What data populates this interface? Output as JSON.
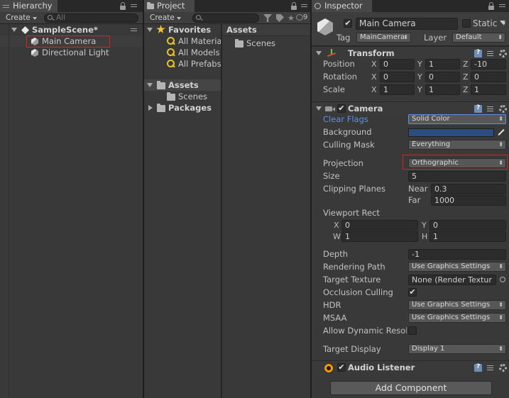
{
  "hierarchy": {
    "tab": "Hierarchy",
    "create": "Create",
    "search_placeholder": "All",
    "scene": "SampleScene*",
    "items": [
      "Main Camera",
      "Directional Light"
    ]
  },
  "project": {
    "tab": "Project",
    "create": "Create",
    "hidden_count": "9",
    "favorites": {
      "label": "Favorites",
      "items": [
        "All Materia",
        "All Models",
        "All Prefabs"
      ]
    },
    "tree": {
      "assets": "Assets",
      "scenes": "Scenes",
      "packages": "Packages"
    },
    "content": {
      "header": "Assets",
      "items": [
        "Scenes"
      ]
    }
  },
  "inspector": {
    "tab": "Inspector",
    "object_name": "Main Camera",
    "active": true,
    "static_label": "Static",
    "tag_label": "Tag",
    "tag_value": "MainCamera",
    "layer_label": "Layer",
    "layer_value": "Default",
    "transform": {
      "title": "Transform",
      "position": {
        "label": "Position",
        "x": "0",
        "y": "1",
        "z": "-10"
      },
      "rotation": {
        "label": "Rotation",
        "x": "0",
        "y": "0",
        "z": "0"
      },
      "scale": {
        "label": "Scale",
        "x": "1",
        "y": "1",
        "z": "1"
      }
    },
    "camera": {
      "title": "Camera",
      "clear_flags": {
        "label": "Clear Flags",
        "value": "Solid Color"
      },
      "background": {
        "label": "Background",
        "color": "#2b4d80"
      },
      "culling_mask": {
        "label": "Culling Mask",
        "value": "Everything"
      },
      "projection": {
        "label": "Projection",
        "value": "Orthographic"
      },
      "size": {
        "label": "Size",
        "value": "5"
      },
      "clipping": {
        "label": "Clipping Planes",
        "near_label": "Near",
        "near": "0.3",
        "far_label": "Far",
        "far": "1000"
      },
      "viewport": {
        "label": "Viewport Rect",
        "x": "0",
        "y": "0",
        "w": "1",
        "h": "1"
      },
      "depth": {
        "label": "Depth",
        "value": "-1"
      },
      "rendering_path": {
        "label": "Rendering Path",
        "value": "Use Graphics Settings"
      },
      "target_texture": {
        "label": "Target Texture",
        "value": "None (Render Textur"
      },
      "occlusion": {
        "label": "Occlusion Culling"
      },
      "hdr": {
        "label": "HDR",
        "value": "Use Graphics Settings"
      },
      "msaa": {
        "label": "MSAA",
        "value": "Use Graphics Settings"
      },
      "dynamic_res": {
        "label": "Allow Dynamic Resol"
      },
      "target_display": {
        "label": "Target Display",
        "value": "Display 1"
      }
    },
    "audio_listener": {
      "title": "Audio Listener"
    },
    "add_component": "Add Component"
  },
  "colors": {
    "highlight": "#d62424",
    "link_blue": "#5e8ee8",
    "panel": "#393939"
  }
}
